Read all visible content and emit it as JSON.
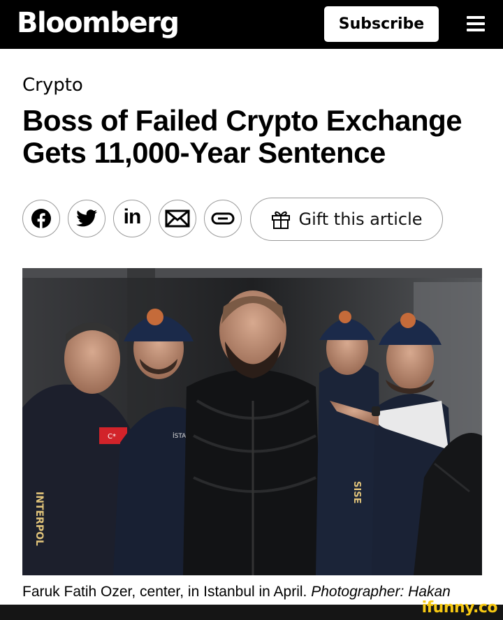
{
  "header": {
    "logo": "Bloomberg",
    "subscribe_label": "Subscribe",
    "menu_icon": "hamburger-menu-icon"
  },
  "article": {
    "kicker": "Crypto",
    "headline": "Boss of Failed Crypto Exchange Gets 11,000-Year Sentence",
    "share": {
      "icons": [
        "facebook-icon",
        "twitter-icon",
        "linkedin-icon",
        "email-icon",
        "link-icon"
      ],
      "linkedin_text": "in",
      "gift_icon": "gift-icon",
      "gift_label": "Gift this article"
    },
    "photo": {
      "caption": "Faruk Fatih Ozer, center, in Istanbul in April.",
      "credit": "Photographer: Hakan",
      "jacket_lettering": "INTERPOL",
      "patch_text": "İSTA"
    }
  },
  "watermark": "ifunny.co",
  "colors": {
    "header_bg": "#000000",
    "watermark": "#f6c812",
    "text": "#000000"
  }
}
